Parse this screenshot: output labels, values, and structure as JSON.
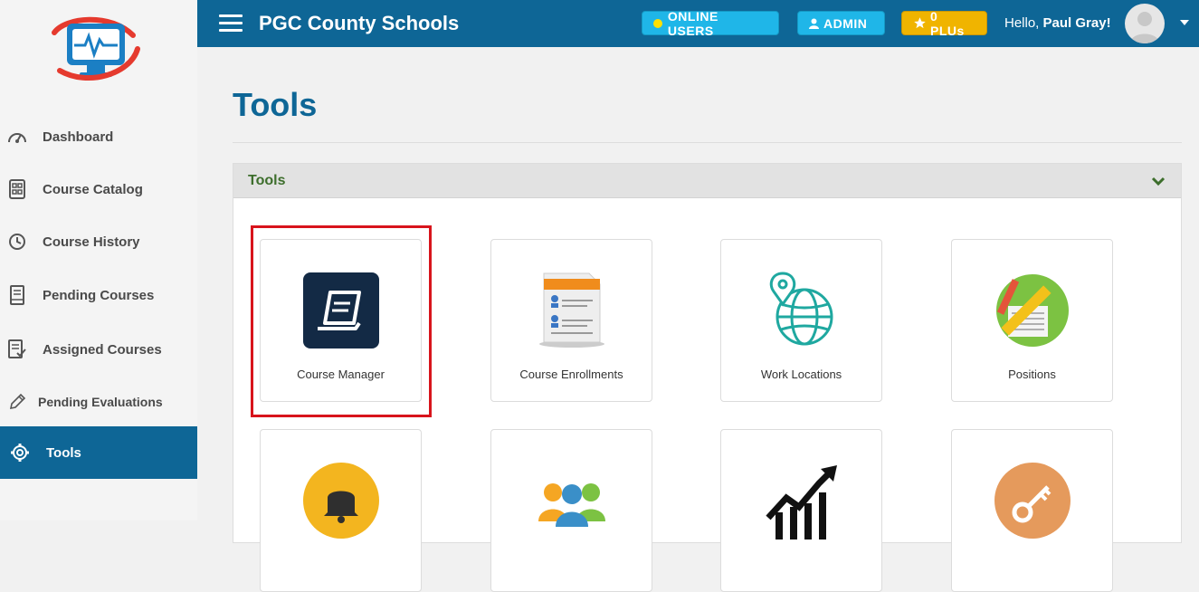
{
  "header": {
    "title": "PGC County Schools",
    "online_users": "ONLINE USERS",
    "admin": "ADMIN",
    "plus": "0 PLUs",
    "greeting": "Hello,",
    "user_name": "Paul Gray!"
  },
  "sidebar": {
    "items": [
      {
        "label": "Dashboard",
        "icon": "gauge-icon"
      },
      {
        "label": "Course Catalog",
        "icon": "catalog-icon"
      },
      {
        "label": "Course History",
        "icon": "clock-icon"
      },
      {
        "label": "Pending Courses",
        "icon": "book-icon"
      },
      {
        "label": "Assigned Courses",
        "icon": "checklist-icon"
      },
      {
        "label": "Pending Evaluations",
        "icon": "pencil-icon"
      },
      {
        "label": "Tools",
        "icon": "gear-icon",
        "active": true
      }
    ]
  },
  "main": {
    "page_title": "Tools",
    "panel_title": "Tools",
    "tiles": [
      {
        "label": "Course Manager",
        "icon": "book-app-icon"
      },
      {
        "label": "Course Enrollments",
        "icon": "enrollment-doc-icon"
      },
      {
        "label": "Work Locations",
        "icon": "globe-pin-icon"
      },
      {
        "label": "Positions",
        "icon": "ruler-pencil-icon"
      },
      {
        "label": "",
        "icon": "bell-icon"
      },
      {
        "label": "",
        "icon": "users-group-icon"
      },
      {
        "label": "",
        "icon": "trend-chart-icon"
      },
      {
        "label": "",
        "icon": "key-icon"
      }
    ]
  },
  "colors": {
    "brand": "#0e6696",
    "accent": "#1fb6e8",
    "gold": "#f0b400",
    "highlight": "#d8141c"
  }
}
